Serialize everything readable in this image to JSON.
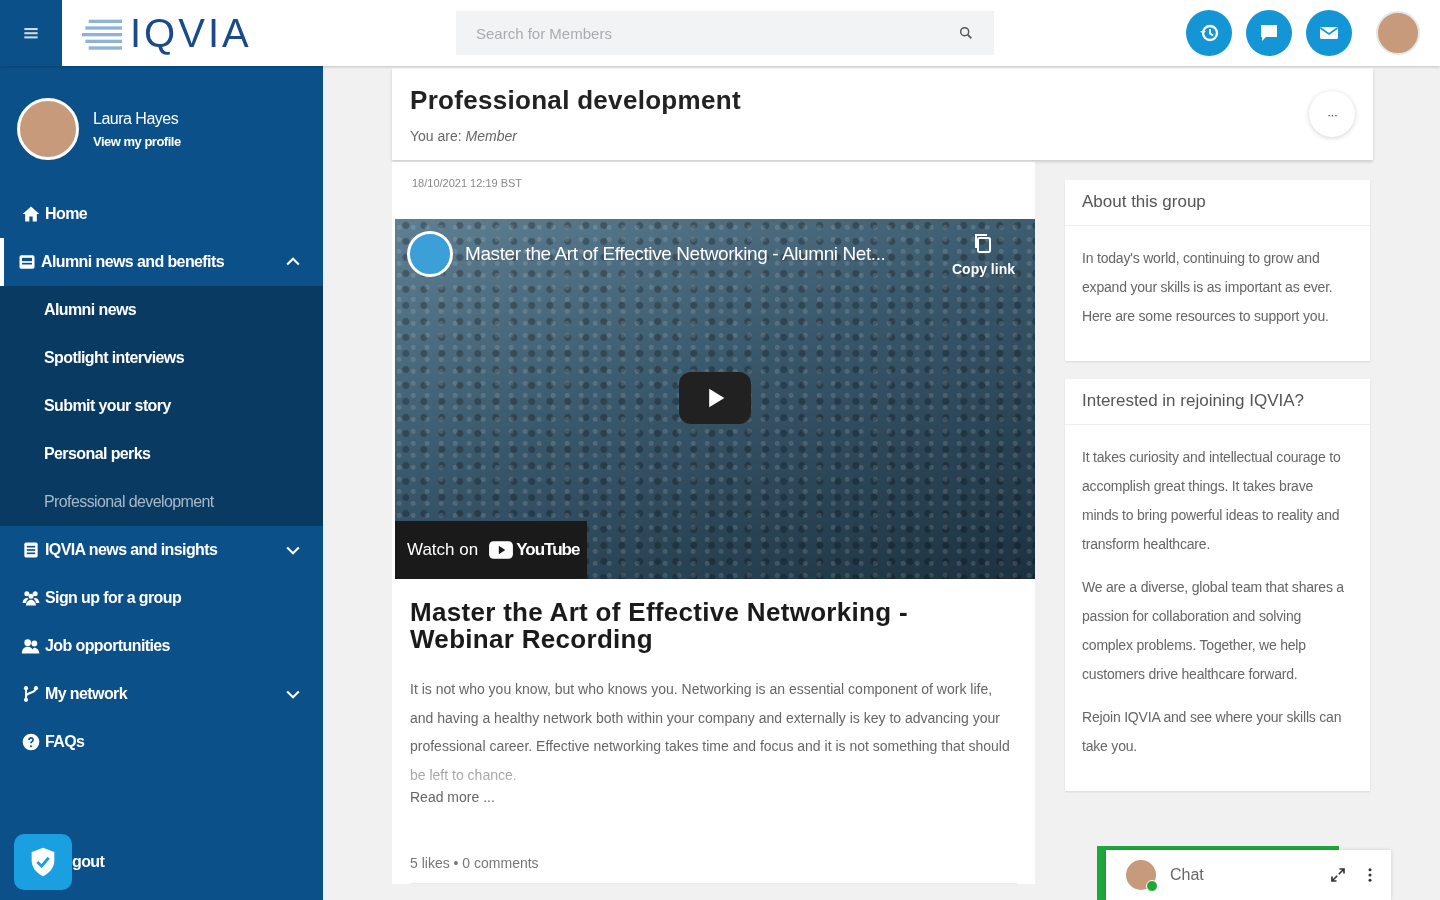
{
  "header": {
    "logo": "IQVIA",
    "search": {
      "placeholder": "Search for Members"
    }
  },
  "sidebar": {
    "profile": {
      "name": "Laura Hayes",
      "link": "View my profile"
    },
    "items": [
      {
        "label": "Home",
        "selected": false
      },
      {
        "label": "Alumni news and benefits",
        "selected": true,
        "expanded": true,
        "children": [
          {
            "label": "Alumni news",
            "selected": false
          },
          {
            "label": "Spotlight interviews",
            "selected": false
          },
          {
            "label": "Submit your story",
            "selected": false
          },
          {
            "label": "Personal perks",
            "selected": false
          },
          {
            "label": "Professional development",
            "selected": true
          }
        ]
      },
      {
        "label": "IQVIA news and insights",
        "selected": false,
        "expanded": false
      },
      {
        "label": "Sign up for a group",
        "selected": false
      },
      {
        "label": "Job opportunities",
        "selected": false
      },
      {
        "label": "My network",
        "selected": false,
        "expanded": false
      },
      {
        "label": "FAQs",
        "selected": false
      }
    ],
    "logout_label": "gout"
  },
  "group": {
    "title": "Professional development",
    "role": "You are: *Member*",
    "menu": "···"
  },
  "post": {
    "date": "18/10/2021 12:19 BST",
    "video": {
      "title": "Master the Art of Effective Networking - Alumni Net...",
      "copy_link": "Copy link",
      "watch_on": "Watch on",
      "platform": "YouTube"
    },
    "title": "Master the Art of Effective Networking - Webinar Recording",
    "body": "It is not who you know, but who knows you. Networking is an essential component of work life, and having a healthy network both within your company and externally is key to advancing your professional career. Effective networking takes time and focus and it is not something that should be left to chance.",
    "read_more": "Read more ...",
    "stats": "5 likes • 0 comments"
  },
  "info_cards": [
    {
      "title": "About this group",
      "paragraphs": [
        "In today's world, continuing to grow and expand your skills is as important as ever. Here are some resources to support you."
      ]
    },
    {
      "title": "Interested in rejoining IQVIA?",
      "paragraphs": [
        "It takes curiosity and intellectual courage to accomplish great things. It takes brave minds to bring powerful ideas to reality and transform healthcare.",
        "We are a diverse, global team that shares a passion for collaboration and solving complex problems. Together, we help customers drive healthcare forward.",
        "Rejoin IQVIA and see where your skills can take you."
      ]
    }
  ],
  "chat": {
    "label": "Chat",
    "online": true
  }
}
